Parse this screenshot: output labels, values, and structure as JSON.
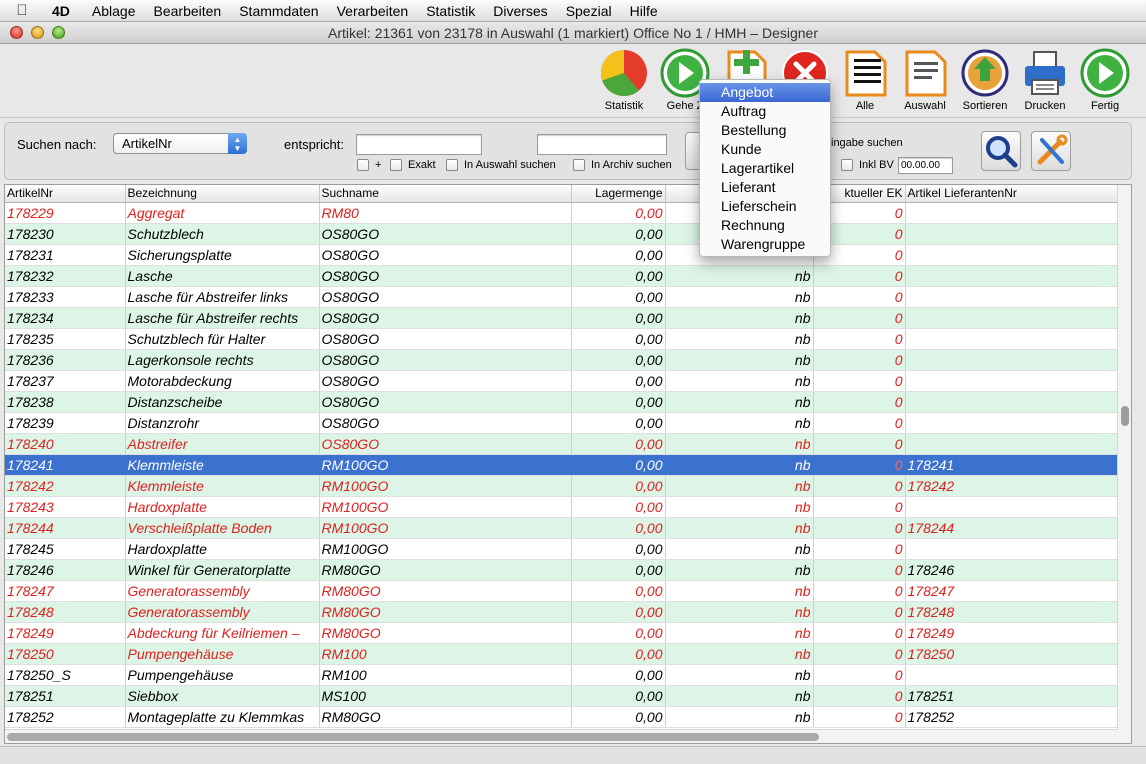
{
  "menubar": {
    "app": "4D",
    "items": [
      "Ablage",
      "Bearbeiten",
      "Stammdaten",
      "Verarbeiten",
      "Statistik",
      "Diverses",
      "Spezial",
      "Hilfe"
    ]
  },
  "window": {
    "title": "Artikel: 21361 von 23178 in Auswahl  (1 markiert) Office No 1 /  HMH – Designer"
  },
  "toolbar": {
    "statistik": "Statistik",
    "gehe_zu": "Gehe Z",
    "alle": "Alle",
    "auswahl": "Auswahl",
    "sortieren": "Sortieren",
    "drucken": "Drucken",
    "fertig": "Fertig"
  },
  "search": {
    "label": "Suchen nach:",
    "field_value": "ArtikelNr",
    "entspricht_label": "entspricht:",
    "entspricht_value": "",
    "second_value": "",
    "plus_label": "+",
    "exakt_label": "Exakt",
    "in_auswahl_label": "In Auswahl suchen",
    "in_archiv_label": "In Archiv suchen",
    "eingabe_label": "ingabe suchen",
    "inkl_bv_label": "Inkl BV",
    "bv_value": "00.00.00"
  },
  "dropdown": {
    "items": [
      "Angebot",
      "Auftrag",
      "Bestellung",
      "Kunde",
      "Lagerartikel",
      "Lieferant",
      "Lieferschein",
      "Rechnung",
      "Warengruppe"
    ]
  },
  "table": {
    "columns": [
      "ArtikelNr",
      "Bezeichnung",
      "Suchname",
      "Lagermenge",
      "",
      "ktueller EK",
      "Artikel LieferantenNr"
    ],
    "rows": [
      {
        "nr": "178229",
        "bez": "Aggregat",
        "such": "RM80",
        "lager": "0,00",
        "nb": "",
        "ek": "0",
        "lief": ""
      },
      {
        "nr": "178230",
        "bez": "Schutzblech",
        "such": "OS80GO",
        "lager": "0,00",
        "nb": "",
        "ek": "0",
        "lief": ""
      },
      {
        "nr": "178231",
        "bez": "Sicherungsplatte",
        "such": "OS80GO",
        "lager": "0,00",
        "nb": "",
        "ek": "0",
        "lief": ""
      },
      {
        "nr": "178232",
        "bez": "Lasche",
        "such": "OS80GO",
        "lager": "0,00",
        "nb": "nb",
        "ek": "0",
        "lief": ""
      },
      {
        "nr": "178233",
        "bez": "Lasche für Abstreifer links",
        "such": "OS80GO",
        "lager": "0,00",
        "nb": "nb",
        "ek": "0",
        "lief": ""
      },
      {
        "nr": "178234",
        "bez": "Lasche für Abstreifer rechts",
        "such": "OS80GO",
        "lager": "0,00",
        "nb": "nb",
        "ek": "0",
        "lief": ""
      },
      {
        "nr": "178235",
        "bez": "Schutzblech für Halter",
        "such": "OS80GO",
        "lager": "0,00",
        "nb": "nb",
        "ek": "0",
        "lief": ""
      },
      {
        "nr": "178236",
        "bez": "Lagerkonsole rechts",
        "such": "OS80GO",
        "lager": "0,00",
        "nb": "nb",
        "ek": "0",
        "lief": ""
      },
      {
        "nr": "178237",
        "bez": "Motorabdeckung",
        "such": "OS80GO",
        "lager": "0,00",
        "nb": "nb",
        "ek": "0",
        "lief": ""
      },
      {
        "nr": "178238",
        "bez": "Distanzscheibe",
        "such": "OS80GO",
        "lager": "0,00",
        "nb": "nb",
        "ek": "0",
        "lief": ""
      },
      {
        "nr": "178239",
        "bez": "Distanzrohr",
        "such": "OS80GO",
        "lager": "0,00",
        "nb": "nb",
        "ek": "0",
        "lief": ""
      },
      {
        "nr": "178240",
        "bez": "Abstreifer",
        "such": "OS80GO",
        "lager": "0,00",
        "nb": "nb",
        "ek": "0",
        "lief": ""
      },
      {
        "nr": "178241",
        "bez": "Klemmleiste",
        "such": "RM100GO",
        "lager": "0,00",
        "nb": "nb",
        "ek": "0",
        "lief": "178241"
      },
      {
        "nr": "178242",
        "bez": "Klemmleiste",
        "such": "RM100GO",
        "lager": "0,00",
        "nb": "nb",
        "ek": "0",
        "lief": "178242"
      },
      {
        "nr": "178243",
        "bez": "Hardoxplatte",
        "such": "RM100GO",
        "lager": "0,00",
        "nb": "nb",
        "ek": "0",
        "lief": ""
      },
      {
        "nr": "178244",
        "bez": "Verschleißplatte Boden",
        "such": "RM100GO",
        "lager": "0,00",
        "nb": "nb",
        "ek": "0",
        "lief": "178244"
      },
      {
        "nr": "178245",
        "bez": "Hardoxplatte",
        "such": "RM100GO",
        "lager": "0,00",
        "nb": "nb",
        "ek": "0",
        "lief": ""
      },
      {
        "nr": "178246",
        "bez": "Winkel für Generatorplatte",
        "such": "RM80GO",
        "lager": "0,00",
        "nb": "nb",
        "ek": "0",
        "lief": "178246"
      },
      {
        "nr": "178247",
        "bez": "Generatorassembly",
        "such": "RM80GO",
        "lager": "0,00",
        "nb": "nb",
        "ek": "0",
        "lief": "178247"
      },
      {
        "nr": "178248",
        "bez": "Generatorassembly",
        "such": "RM80GO",
        "lager": "0,00",
        "nb": "nb",
        "ek": "0",
        "lief": "178248"
      },
      {
        "nr": "178249",
        "bez": "Abdeckung für Keilriemen –",
        "such": "RM80GO",
        "lager": "0,00",
        "nb": "nb",
        "ek": "0",
        "lief": "178249"
      },
      {
        "nr": "178250",
        "bez": "Pumpengehäuse",
        "such": "RM100",
        "lager": "0,00",
        "nb": "nb",
        "ek": "0",
        "lief": "178250"
      },
      {
        "nr": "178250_S",
        "bez": "Pumpengehäuse",
        "such": "RM100",
        "lager": "0,00",
        "nb": "nb",
        "ek": "0",
        "lief": ""
      },
      {
        "nr": "178251",
        "bez": "Siebbox",
        "such": "MS100",
        "lager": "0,00",
        "nb": "nb",
        "ek": "0",
        "lief": "178251"
      },
      {
        "nr": "178252",
        "bez": "Montageplatte zu Klemmkas",
        "such": "RM80GO",
        "lager": "0,00",
        "nb": "nb",
        "ek": "0",
        "lief": "178252"
      }
    ]
  },
  "colors": {
    "row_alt": "#dcf5e7",
    "text_red": "#e0201c",
    "selection": "#3b71cf"
  }
}
